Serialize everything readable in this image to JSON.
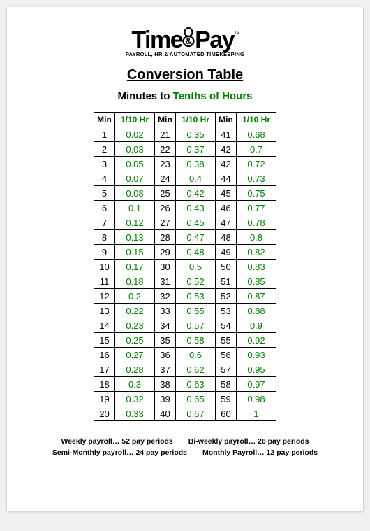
{
  "logo": {
    "word1": "Time",
    "word2": "Pay",
    "tm": "™",
    "tagline": "PAYROLL, HR & AUTOMATED TIMEKEEPING"
  },
  "title": "Conversion Table",
  "subtitle_prefix": "Minutes to ",
  "subtitle_green": "Tenths of Hours",
  "headers": {
    "min": "Min",
    "hr": "1/10 Hr"
  },
  "chart_data": {
    "type": "table",
    "title": "Minutes to Tenths of Hours Conversion",
    "columns": [
      "Min",
      "1/10 Hr"
    ],
    "rows": [
      [
        1,
        "0.02"
      ],
      [
        2,
        "0.03"
      ],
      [
        3,
        "0.05"
      ],
      [
        4,
        "0.07"
      ],
      [
        5,
        "0.08"
      ],
      [
        6,
        "0.1"
      ],
      [
        7,
        "0.12"
      ],
      [
        8,
        "0.13"
      ],
      [
        9,
        "0.15"
      ],
      [
        10,
        "0.17"
      ],
      [
        11,
        "0.18"
      ],
      [
        12,
        "0.2"
      ],
      [
        13,
        "0.22"
      ],
      [
        14,
        "0.23"
      ],
      [
        15,
        "0.25"
      ],
      [
        16,
        "0.27"
      ],
      [
        17,
        "0.28"
      ],
      [
        18,
        "0.3"
      ],
      [
        19,
        "0.32"
      ],
      [
        20,
        "0.33"
      ],
      [
        21,
        "0.35"
      ],
      [
        22,
        "0.37"
      ],
      [
        23,
        "0.38"
      ],
      [
        24,
        "0.4"
      ],
      [
        25,
        "0.42"
      ],
      [
        26,
        "0.43"
      ],
      [
        27,
        "0.45"
      ],
      [
        28,
        "0.47"
      ],
      [
        29,
        "0.48"
      ],
      [
        30,
        "0.5"
      ],
      [
        31,
        "0.52"
      ],
      [
        32,
        "0.53"
      ],
      [
        33,
        "0.55"
      ],
      [
        34,
        "0.57"
      ],
      [
        35,
        "0.58"
      ],
      [
        36,
        "0.6"
      ],
      [
        37,
        "0.62"
      ],
      [
        38,
        "0.63"
      ],
      [
        39,
        "0.65"
      ],
      [
        40,
        "0.67"
      ],
      [
        41,
        "0.68"
      ],
      [
        42,
        "0.7"
      ],
      [
        42,
        "0.72"
      ],
      [
        44,
        "0.73"
      ],
      [
        45,
        "0.75"
      ],
      [
        46,
        "0.77"
      ],
      [
        47,
        "0.78"
      ],
      [
        48,
        "0.8"
      ],
      [
        49,
        "0.82"
      ],
      [
        50,
        "0.83"
      ],
      [
        51,
        "0.85"
      ],
      [
        52,
        "0.87"
      ],
      [
        53,
        "0.88"
      ],
      [
        54,
        "0.9"
      ],
      [
        55,
        "0.92"
      ],
      [
        56,
        "0.93"
      ],
      [
        57,
        "0.95"
      ],
      [
        58,
        "0.97"
      ],
      [
        59,
        "0.98"
      ],
      [
        60,
        "1"
      ]
    ]
  },
  "footer": {
    "l1a": "Weekly payroll… 52 pay periods",
    "l1b": "Bi-weekly payroll… 26 pay periods",
    "l2a": "Semi-Monthly payroll… 24 pay periods",
    "l2b": "Monthly Payroll… 12 pay periods"
  }
}
